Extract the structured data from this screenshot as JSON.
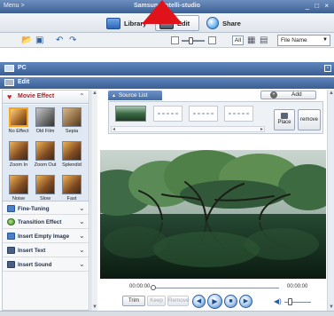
{
  "window": {
    "menu_label": "Menu >",
    "title": "Samsung Intelli-studio",
    "controls": "_ □ ×"
  },
  "modes": {
    "library": "Library",
    "edit": "Edit",
    "share": "Share"
  },
  "toolbar": {
    "zoom_level": 0.35,
    "all_label": "All",
    "sort_value": "File Name",
    "icons": [
      "open-folder-icon",
      "save-icon",
      "undo-icon",
      "redo-icon",
      "grid-view-icon",
      "list-view-icon"
    ]
  },
  "pc_bar": {
    "label": "PC"
  },
  "edit_bar": {
    "label": "Edit"
  },
  "left_panel": {
    "header": "Movie Effect",
    "effects": [
      "No Effect",
      "Old Film",
      "Sepia",
      "Zoom In",
      "Zoom Out",
      "Splendid",
      "Noise",
      "Slow",
      "Fast"
    ],
    "selected_effect": "No Effect",
    "items": [
      "Fine-Tuning",
      "Transition Effect",
      "Insert Empty Image",
      "Insert Text",
      "Insert Sound"
    ]
  },
  "source": {
    "title": "Source List",
    "add_label": "Add",
    "place_label": "Place",
    "remove_label": "remove"
  },
  "player": {
    "time_current": "00:00:00",
    "time_total": "00:00:00",
    "trim_label": "Trim",
    "keep_label": "Keep",
    "remove_label": "Remove",
    "volume_level": 0.3
  },
  "colors": {
    "title_bar": "#4a6ea3",
    "panel_header_red": "#a3262b",
    "pointer_red": "#e0121a"
  }
}
